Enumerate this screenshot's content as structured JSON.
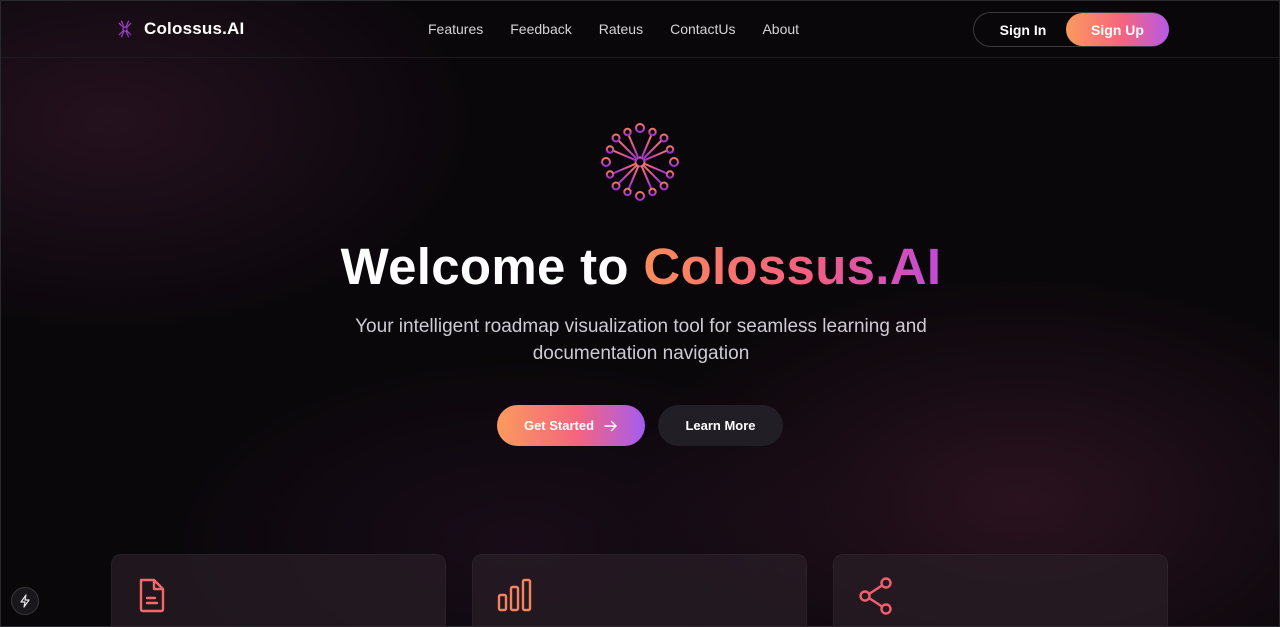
{
  "header": {
    "brand_name": "Colossus.AI",
    "nav": [
      "Features",
      "Feedback",
      "Rateus",
      "ContactUs",
      "About"
    ],
    "sign_in_label": "Sign In",
    "sign_up_label": "Sign Up"
  },
  "hero": {
    "title_prefix": "Welcome to ",
    "title_highlight": "Colossus.AI",
    "subtitle": "Your intelligent roadmap visualization tool for seamless learning and documentation navigation",
    "get_started_label": "Get Started",
    "learn_more_label": "Learn More"
  },
  "feature_cards": [
    {
      "icon": "document-icon"
    },
    {
      "icon": "bar-chart-icon"
    },
    {
      "icon": "share-icon"
    }
  ],
  "colors": {
    "accent_orange": "#fb9a5e",
    "accent_pink": "#f4647f",
    "accent_purple": "#b65ae8",
    "background": "#0a070b"
  }
}
